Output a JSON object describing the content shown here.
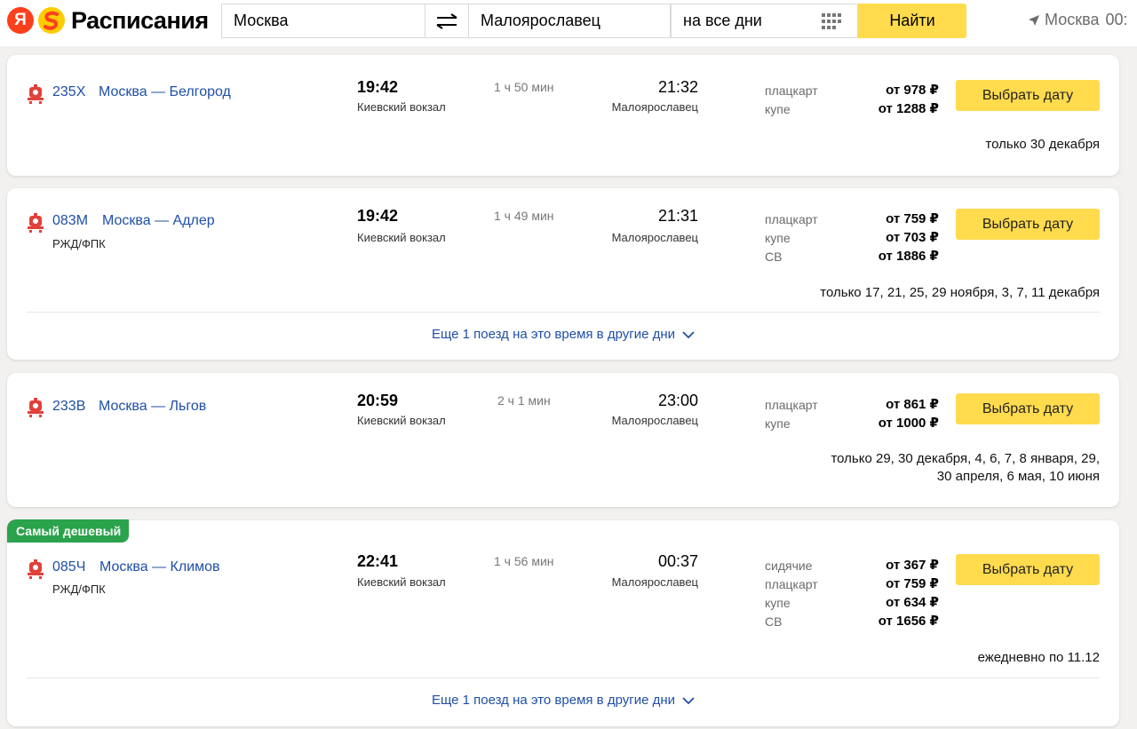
{
  "header": {
    "logo_letter": "Я",
    "logo_text": "Расписания",
    "from_value": "Москва",
    "to_value": "Малоярославец",
    "date_value": "на все дни",
    "search_label": "Найти",
    "geo_label": "Москва",
    "geo_time": "00:"
  },
  "colors": {
    "accent": "#ffdb4d",
    "link": "#1f4fa6",
    "badge": "#2ba24c",
    "train_icon": "#e0413a"
  },
  "trains": [
    {
      "number": "235Х",
      "route": "Москва — Белгород",
      "carrier": "",
      "dep_time": "19:42",
      "dep_station": "Киевский вокзал",
      "duration": "1 ч 50 мин",
      "arr_time": "21:32",
      "arr_station": "Малоярославец",
      "classes": [
        {
          "name": "плацкарт",
          "price": "от 978 ₽"
        },
        {
          "name": "купе",
          "price": "от 1288 ₽"
        }
      ],
      "button": "Выбрать дату",
      "days": "только 30 декабря"
    },
    {
      "number": "083М",
      "route": "Москва — Адлер",
      "carrier": "РЖД/ФПК",
      "dep_time": "19:42",
      "dep_station": "Киевский вокзал",
      "duration": "1 ч 49 мин",
      "arr_time": "21:31",
      "arr_station": "Малоярославец",
      "classes": [
        {
          "name": "плацкарт",
          "price": "от 759 ₽"
        },
        {
          "name": "купе",
          "price": "от 703 ₽"
        },
        {
          "name": "СВ",
          "price": "от 1886 ₽"
        }
      ],
      "button": "Выбрать дату",
      "days": "только 17, 21, 25, 29 ноября, 3, 7, 11 декабря",
      "more": "Еще 1 поезд на это время в другие дни"
    },
    {
      "number": "233В",
      "route": "Москва — Льгов",
      "carrier": "",
      "dep_time": "20:59",
      "dep_station": "Киевский вокзал",
      "duration": "2 ч 1 мин",
      "arr_time": "23:00",
      "arr_station": "Малоярославец",
      "classes": [
        {
          "name": "плацкарт",
          "price": "от 861 ₽"
        },
        {
          "name": "купе",
          "price": "от 1000 ₽"
        }
      ],
      "button": "Выбрать дату",
      "days_line1": "только 29, 30 декабря, 4, 6, 7, 8 января, 29,",
      "days_line2": "30 апреля, 6 мая, 10 июня"
    },
    {
      "badge": "Самый дешевый",
      "number": "085Ч",
      "route": "Москва — Климов",
      "carrier": "РЖД/ФПК",
      "dep_time": "22:41",
      "dep_station": "Киевский вокзал",
      "duration": "1 ч 56 мин",
      "arr_time": "00:37",
      "arr_station": "Малоярославец",
      "classes": [
        {
          "name": "сидячие",
          "price": "от 367 ₽"
        },
        {
          "name": "плацкарт",
          "price": "от 759 ₽"
        },
        {
          "name": "купе",
          "price": "от 634 ₽"
        },
        {
          "name": "СВ",
          "price": "от 1656 ₽"
        }
      ],
      "button": "Выбрать дату",
      "days": "ежедневно по 11.12",
      "more": "Еще 1 поезд на это время в другие дни"
    }
  ]
}
